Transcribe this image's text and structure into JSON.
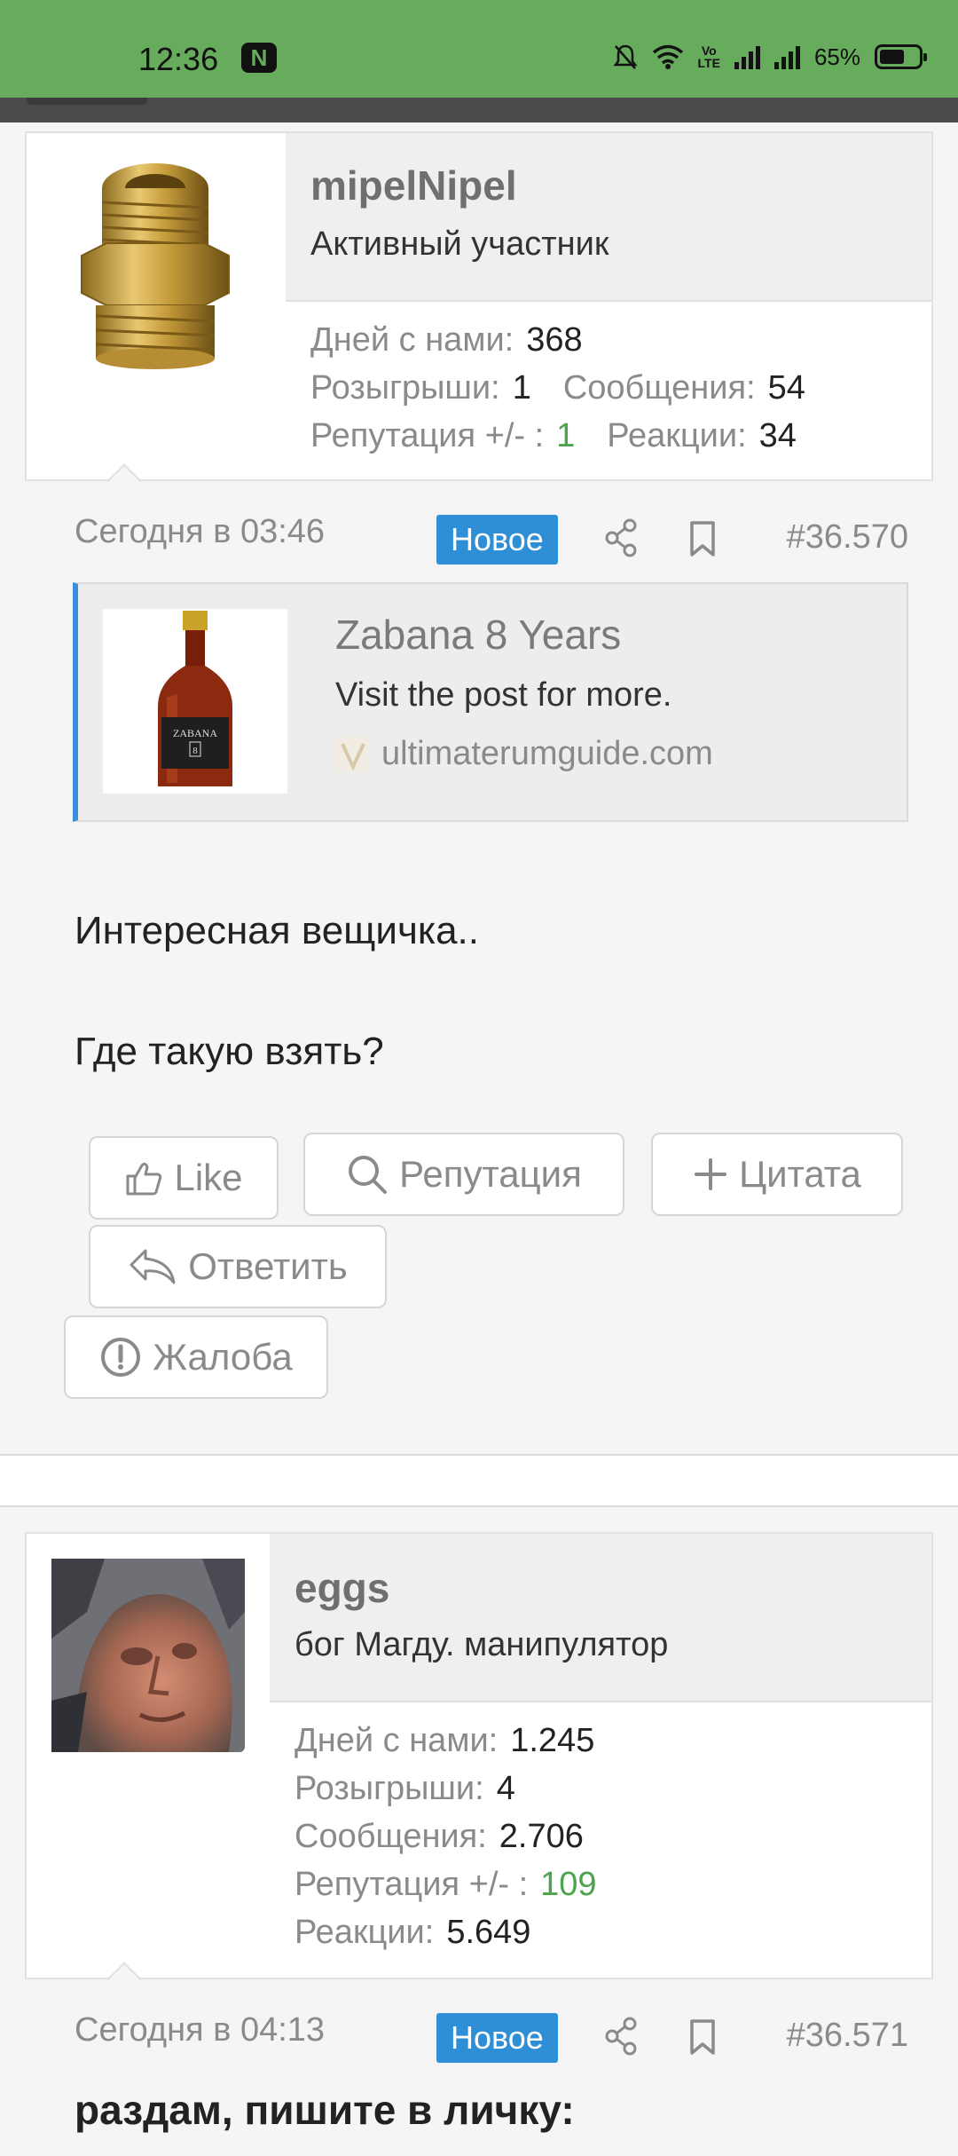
{
  "status_bar": {
    "time": "12:36",
    "app_badge": "N",
    "battery": "65%",
    "volte": "Vo LTE"
  },
  "posts": [
    {
      "username": "mipelNipel",
      "user_title": "Активный участник",
      "stats": {
        "days_label": "Дней с нами:",
        "days": "368",
        "draws_label": "Розыгрыши:",
        "draws": "1",
        "messages_label": "Сообщения:",
        "messages": "54",
        "reputation_label": "Репутация +/- :",
        "reputation": "1",
        "reactions_label": "Реакции:",
        "reactions": "34"
      },
      "date": "Сегодня в 03:46",
      "badge": "Новое",
      "number": "#36.570",
      "embed": {
        "title": "Zabana 8 Years",
        "description": "Visit the post for more.",
        "site": "ultimaterumguide.com",
        "bottle_label": "ZABANA"
      },
      "message_lines": [
        "Интересная вещичка..",
        "Где такую взять?"
      ],
      "actions": {
        "like": "Like",
        "reputation": "Репутация",
        "quote": "Цитата",
        "reply": "Ответить",
        "report": "Жалоба"
      }
    },
    {
      "username": "eggs",
      "user_title": "бог Магду. манипулятор",
      "stats": {
        "days_label": "Дней с нами:",
        "days": "1.245",
        "draws_label": "Розыгрыши:",
        "draws": "4",
        "messages_label": "Сообщения:",
        "messages": "2.706",
        "reputation_label": "Репутация +/- :",
        "reputation": "109",
        "reactions_label": "Реакции:",
        "reactions": "5.649"
      },
      "date": "Сегодня в 04:13",
      "badge": "Новое",
      "number": "#36.571",
      "message_lines": [
        "раздам, пишите в личку:"
      ]
    }
  ],
  "colors": {
    "status_bar": "#67ab5c",
    "badge": "#2e8fd6",
    "reputation_positive": "#4da44c",
    "embed_accent": "#3a8fd8"
  }
}
